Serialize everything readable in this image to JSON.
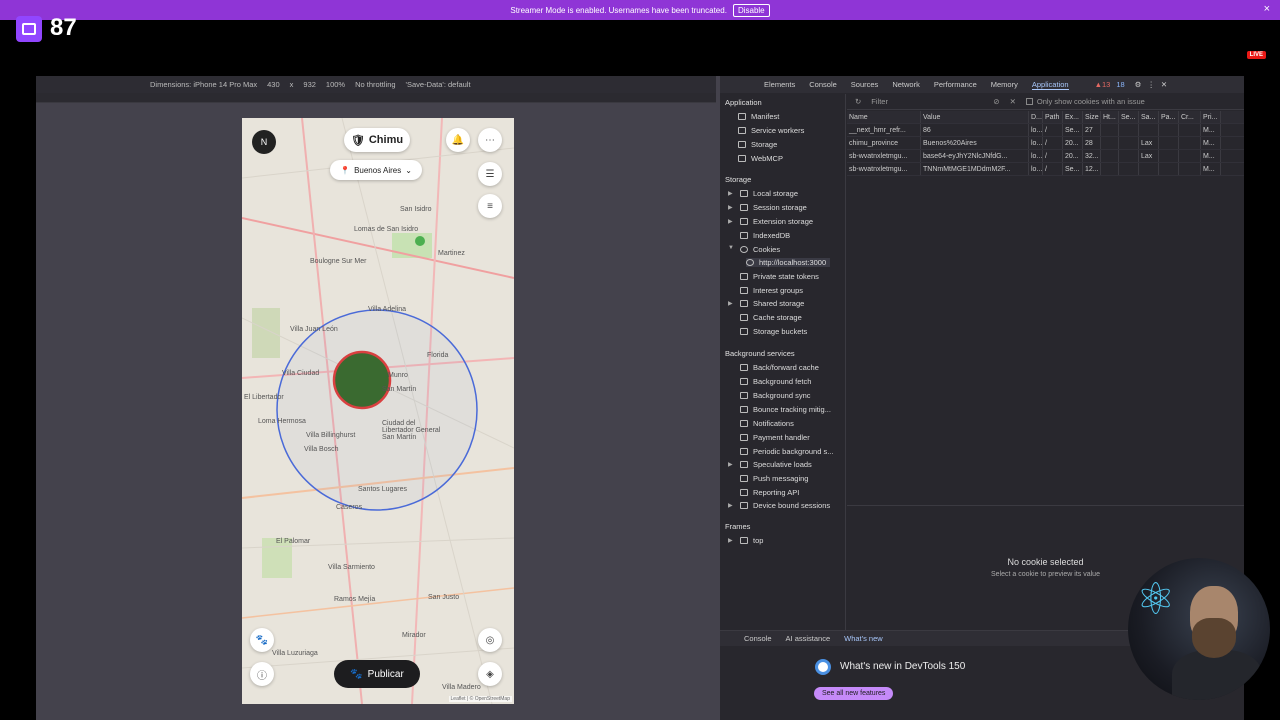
{
  "banner": {
    "text": "Streamer Mode is enabled. Usernames have been truncated.",
    "button": "Disable",
    "close": "×"
  },
  "stream": {
    "viewer_count": "87",
    "live_badge": "LIVE"
  },
  "device_toolbar": {
    "dimensions_label": "Dimensions: iPhone 14 Pro Max",
    "width": "430",
    "x": "x",
    "height": "932",
    "zoom": "100%",
    "throttling": "No throttling",
    "save_data": "'Save-Data': default"
  },
  "app": {
    "avatar_initial": "N",
    "title_chip": "Chimu",
    "location_chip": "Buenos Aires",
    "publish_button": "Publicar",
    "attribution": "Leaflet | © OpenStreetMap",
    "map_labels": [
      "San Isidro",
      "Lomas de San Isidro",
      "Martinez",
      "Boulogne Sur Mer",
      "Villa Adelina",
      "Florida",
      "Villa Juan León",
      "Villa Ciudad",
      "Munro",
      "San Martín",
      "El Libertador",
      "Loma Hermosa",
      "Villa Billinghurst",
      "Ciudad del Libertador General San Martín",
      "Villa Bosch",
      "Santos Lugares",
      "Caseros",
      "El Palomar",
      "Villa Sarmiento",
      "Ramos Mejía",
      "San Justo",
      "Villa Luzuriaga",
      "Mirador",
      "Villa Madero"
    ]
  },
  "devtools": {
    "tabs": [
      "Elements",
      "Console",
      "Sources",
      "Network",
      "Performance",
      "Memory",
      "Application"
    ],
    "active_tab": "Application",
    "issues": "▲13",
    "messages": "18",
    "sidebar": {
      "application_head": "Application",
      "application_items": [
        "Manifest",
        "Service workers",
        "Storage",
        "WebMCP"
      ],
      "storage_head": "Storage",
      "storage_items": [
        "Local storage",
        "Session storage",
        "Extension storage",
        "IndexedDB",
        "Cookies"
      ],
      "cookie_origin": "http://localhost:3000",
      "storage_items_2": [
        "Private state tokens",
        "Interest groups",
        "Shared storage",
        "Cache storage",
        "Storage buckets"
      ],
      "bg_head": "Background services",
      "bg_items": [
        "Back/forward cache",
        "Background fetch",
        "Background sync",
        "Bounce tracking mitig...",
        "Notifications",
        "Payment handler",
        "Periodic background s...",
        "Speculative loads",
        "Push messaging",
        "Reporting API",
        "Device bound sessions"
      ],
      "frames_head": "Frames",
      "frames_items": [
        "top"
      ]
    },
    "cookie_toolbar": {
      "filter_placeholder": "Filter",
      "only_issue_label": "Only show cookies with an issue"
    },
    "cookie_table": {
      "columns": [
        "Name",
        "Value",
        "D...",
        "Path",
        "Ex...",
        "Size",
        "Ht...",
        "Se...",
        "Sa...",
        "Pa...",
        "Cr...",
        "Pri..."
      ],
      "rows": [
        [
          "__next_hmr_refr...",
          "86",
          "lo...",
          "/",
          "Se...",
          "27",
          "",
          "",
          "",
          "",
          "",
          "M..."
        ],
        [
          "chimu_province",
          "Buenos%20Aires",
          "lo...",
          "/",
          "20...",
          "28",
          "",
          "",
          "Lax",
          "",
          "",
          "M..."
        ],
        [
          "sb-wvatnxletmgu...",
          "base64-eyJhY2NlcJNfdG...",
          "lo...",
          "/",
          "20...",
          "32...",
          "",
          "",
          "Lax",
          "",
          "",
          "M..."
        ],
        [
          "sb-wvatnxletmgu...",
          "TNNmMtMGE1MDdmM2F...",
          "lo...",
          "/",
          "Se...",
          "12...",
          "",
          "",
          "",
          "",
          "",
          "M..."
        ]
      ]
    },
    "preview": {
      "title": "No cookie selected",
      "subtitle": "Select a cookie to preview its value"
    },
    "drawer": {
      "tabs": [
        "Console",
        "AI assistance",
        "What's new"
      ],
      "whats_new_title": "What's new in DevTools 150",
      "see_all": "See all new features"
    }
  }
}
